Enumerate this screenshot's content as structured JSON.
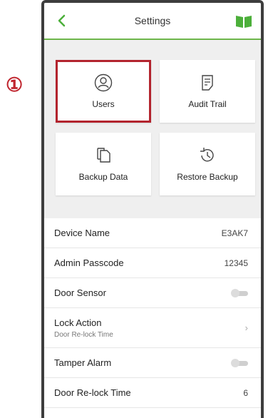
{
  "annotation": {
    "marker": "①"
  },
  "header": {
    "title": "Settings",
    "back_icon": "chevron-left-icon",
    "help_icon": "book-icon",
    "accent": "#6db64a"
  },
  "tiles": [
    {
      "label": "Users",
      "icon": "user-icon",
      "selected": true
    },
    {
      "label": "Audit Trail",
      "icon": "document-icon",
      "selected": false
    },
    {
      "label": "Backup Data",
      "icon": "copy-icon",
      "selected": false
    },
    {
      "label": "Restore Backup",
      "icon": "history-icon",
      "selected": false
    }
  ],
  "settings": {
    "device_name": {
      "label": "Device Name",
      "value": "E3AK7"
    },
    "admin_passcode": {
      "label": "Admin Passcode",
      "value": "12345"
    },
    "door_sensor": {
      "label": "Door Sensor",
      "enabled": false
    },
    "lock_action": {
      "label": "Lock Action",
      "sublabel": "Door Re-lock Time"
    },
    "tamper_alarm": {
      "label": "Tamper Alarm",
      "enabled": false
    },
    "door_relock_time": {
      "label": "Door Re-lock Time",
      "value": "6"
    }
  },
  "colors": {
    "highlight": "#b3242e",
    "background": "#efefef"
  }
}
